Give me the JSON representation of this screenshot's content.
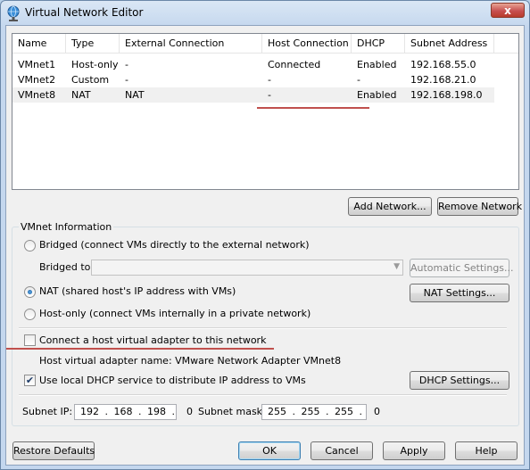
{
  "window": {
    "title": "Virtual Network Editor",
    "close_glyph": "x"
  },
  "table": {
    "columns": [
      "Name",
      "Type",
      "External Connection",
      "Host Connection",
      "DHCP",
      "Subnet Address"
    ],
    "rows": [
      [
        "VMnet1",
        "Host-only",
        "-",
        "Connected",
        "Enabled",
        "192.168.55.0"
      ],
      [
        "VMnet2",
        "Custom",
        "-",
        "-",
        "-",
        "192.168.21.0"
      ],
      [
        "VMnet8",
        "NAT",
        "NAT",
        "-",
        "Enabled",
        "192.168.198.0"
      ]
    ],
    "selected_row": 2
  },
  "buttons": {
    "add_network": "Add Network...",
    "remove_network": "Remove Network",
    "automatic_settings": "Automatic Settings...",
    "nat_settings": "NAT Settings...",
    "dhcp_settings": "DHCP Settings...",
    "restore_defaults": "Restore Defaults",
    "ok": "OK",
    "cancel": "Cancel",
    "apply": "Apply",
    "help": "Help"
  },
  "vmnet_info": {
    "legend": "VMnet Information",
    "bridged_label": "Bridged (connect VMs directly to the external network)",
    "bridged_to_label": "Bridged to:",
    "bridged_to_value": "",
    "nat_label": "NAT (shared host's IP address with VMs)",
    "host_only_label": "Host-only (connect VMs internally in a private network)",
    "selected_mode": "nat",
    "connect_adapter_label": "Connect a host virtual adapter to this network",
    "connect_adapter_checked": false,
    "adapter_name_label": "Host virtual adapter name: VMware Network Adapter VMnet8",
    "dhcp_label": "Use local DHCP service to distribute IP address to VMs",
    "dhcp_checked": true,
    "subnet_ip_label": "Subnet IP:",
    "subnet_ip_value": "192 . 168 . 198 .  0",
    "subnet_mask_label": "Subnet mask:",
    "subnet_mask_value": "255 . 255 . 255 .  0"
  },
  "colors": {
    "annotation": "#c0504d",
    "selection": "#f0f0f0"
  },
  "icons": {
    "app": "network-globe-icon",
    "dropdown": "chevron-down-icon",
    "check": "checkmark-icon"
  }
}
